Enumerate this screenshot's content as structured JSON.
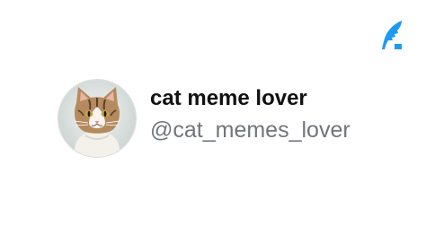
{
  "profile": {
    "display_name": "cat meme lover",
    "handle": "@cat_memes_lover",
    "avatar_icon": "cat-portrait-avatar"
  },
  "brand": {
    "icon": "feather-logo-icon",
    "accent_color": "#1d9bf0"
  },
  "colors": {
    "name": "#111111",
    "handle": "#71767b",
    "background": "#ffffff"
  }
}
